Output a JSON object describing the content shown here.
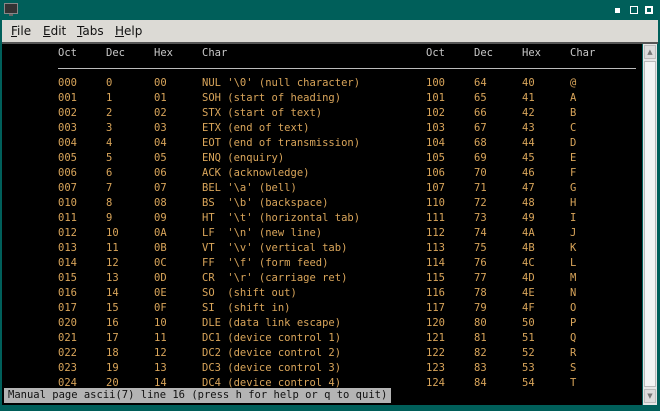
{
  "window": {
    "menu": [
      {
        "u": "F",
        "rest": "ile"
      },
      {
        "u": "E",
        "rest": "dit"
      },
      {
        "u": "T",
        "rest": "abs"
      },
      {
        "u": "H",
        "rest": "elp"
      }
    ]
  },
  "headers": [
    "Oct",
    "Dec",
    "Hex",
    "Char",
    "Oct",
    "Dec",
    "Hex",
    "Char"
  ],
  "rows": [
    [
      "000",
      "0",
      "00",
      "NUL '\\0' (null character)",
      "100",
      "64",
      "40",
      "@"
    ],
    [
      "001",
      "1",
      "01",
      "SOH (start of heading)",
      "101",
      "65",
      "41",
      "A"
    ],
    [
      "002",
      "2",
      "02",
      "STX (start of text)",
      "102",
      "66",
      "42",
      "B"
    ],
    [
      "003",
      "3",
      "03",
      "ETX (end of text)",
      "103",
      "67",
      "43",
      "C"
    ],
    [
      "004",
      "4",
      "04",
      "EOT (end of transmission)",
      "104",
      "68",
      "44",
      "D"
    ],
    [
      "005",
      "5",
      "05",
      "ENQ (enquiry)",
      "105",
      "69",
      "45",
      "E"
    ],
    [
      "006",
      "6",
      "06",
      "ACK (acknowledge)",
      "106",
      "70",
      "46",
      "F"
    ],
    [
      "007",
      "7",
      "07",
      "BEL '\\a' (bell)",
      "107",
      "71",
      "47",
      "G"
    ],
    [
      "010",
      "8",
      "08",
      "BS  '\\b' (backspace)",
      "110",
      "72",
      "48",
      "H"
    ],
    [
      "011",
      "9",
      "09",
      "HT  '\\t' (horizontal tab)",
      "111",
      "73",
      "49",
      "I"
    ],
    [
      "012",
      "10",
      "0A",
      "LF  '\\n' (new line)",
      "112",
      "74",
      "4A",
      "J"
    ],
    [
      "013",
      "11",
      "0B",
      "VT  '\\v' (vertical tab)",
      "113",
      "75",
      "4B",
      "K"
    ],
    [
      "014",
      "12",
      "0C",
      "FF  '\\f' (form feed)",
      "114",
      "76",
      "4C",
      "L"
    ],
    [
      "015",
      "13",
      "0D",
      "CR  '\\r' (carriage ret)",
      "115",
      "77",
      "4D",
      "M"
    ],
    [
      "016",
      "14",
      "0E",
      "SO  (shift out)",
      "116",
      "78",
      "4E",
      "N"
    ],
    [
      "017",
      "15",
      "0F",
      "SI  (shift in)",
      "117",
      "79",
      "4F",
      "O"
    ],
    [
      "020",
      "16",
      "10",
      "DLE (data link escape)",
      "120",
      "80",
      "50",
      "P"
    ],
    [
      "021",
      "17",
      "11",
      "DC1 (device control 1)",
      "121",
      "81",
      "51",
      "Q"
    ],
    [
      "022",
      "18",
      "12",
      "DC2 (device control 2)",
      "122",
      "82",
      "52",
      "R"
    ],
    [
      "023",
      "19",
      "13",
      "DC3 (device control 3)",
      "123",
      "83",
      "53",
      "S"
    ],
    [
      "024",
      "20",
      "14",
      "DC4 (device control 4)",
      "124",
      "84",
      "54",
      "T"
    ]
  ],
  "status": "Manual page ascii(7) line 16 (press h for help or q to quit)"
}
